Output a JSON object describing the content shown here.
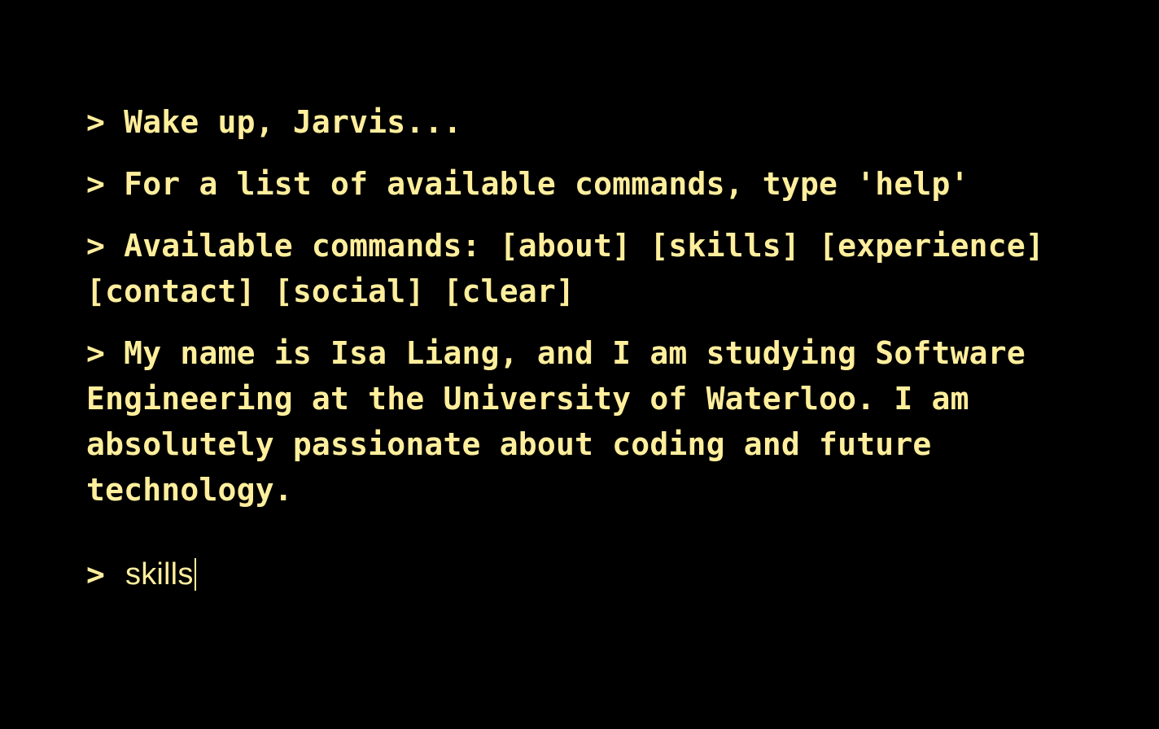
{
  "terminal": {
    "colors": {
      "background": "#000000",
      "text": "#ffee9c"
    },
    "lines": [
      "> Wake up, Jarvis...",
      "> For a list of available commands, type 'help'",
      "> Available commands: [about] [skills] [experience] [contact] [social] [clear]",
      "> My name is Isa Liang, and I am studying Software Engineering at the University of Waterloo. I am absolutely passionate about coding and future technology."
    ],
    "prompt_symbol": ">",
    "input_value": "skills"
  }
}
